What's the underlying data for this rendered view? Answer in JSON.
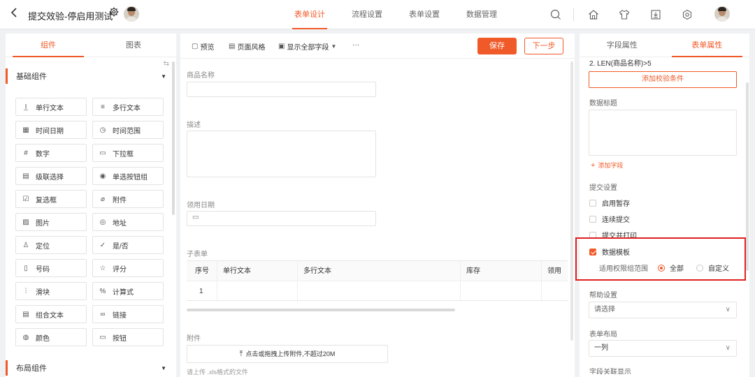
{
  "header": {
    "title": "提交效验-停启用测试",
    "tabs": [
      "表单设计",
      "流程设置",
      "表单设置",
      "数据管理"
    ],
    "active_tab": 0
  },
  "left_panel": {
    "tabs": [
      "组件",
      "图表"
    ],
    "active_tab": 0,
    "basic_section": "基础组件",
    "layout_section": "布局组件",
    "components": [
      {
        "label": "单行文本",
        "icon": "single-line-text-icon",
        "glyph": "I̲"
      },
      {
        "label": "多行文本",
        "icon": "multi-line-text-icon",
        "glyph": "≡"
      },
      {
        "label": "时间日期",
        "icon": "calendar-icon",
        "glyph": "▦"
      },
      {
        "label": "时间范围",
        "icon": "clock-icon",
        "glyph": "◷"
      },
      {
        "label": "数字",
        "icon": "number-icon",
        "glyph": "#"
      },
      {
        "label": "下拉框",
        "icon": "dropdown-icon",
        "glyph": "▭"
      },
      {
        "label": "级联选择",
        "icon": "cascade-icon",
        "glyph": "▤"
      },
      {
        "label": "单选按钮组",
        "icon": "radio-icon",
        "glyph": "◉"
      },
      {
        "label": "复选框",
        "icon": "checkbox-icon",
        "glyph": "☑"
      },
      {
        "label": "附件",
        "icon": "paperclip-icon",
        "glyph": "⌀"
      },
      {
        "label": "图片",
        "icon": "image-icon",
        "glyph": "▨"
      },
      {
        "label": "地址",
        "icon": "location-pin-icon",
        "glyph": "◎"
      },
      {
        "label": "定位",
        "icon": "locate-icon",
        "glyph": "♙"
      },
      {
        "label": "是/否",
        "icon": "yes-no-icon",
        "glyph": "✓"
      },
      {
        "label": "号码",
        "icon": "phone-icon",
        "glyph": "▯"
      },
      {
        "label": "评分",
        "icon": "star-icon",
        "glyph": "☆"
      },
      {
        "label": "滑块",
        "icon": "slider-icon",
        "glyph": "⫶"
      },
      {
        "label": "计算式",
        "icon": "formula-icon",
        "glyph": "%"
      },
      {
        "label": "组合文本",
        "icon": "composite-text-icon",
        "glyph": "▤"
      },
      {
        "label": "链接",
        "icon": "link-icon",
        "glyph": "∞"
      },
      {
        "label": "颜色",
        "icon": "palette-icon",
        "glyph": "◍"
      },
      {
        "label": "按钮",
        "icon": "button-icon",
        "glyph": "▭"
      }
    ]
  },
  "toolbar": {
    "preview": "预览",
    "page_style": "页面风格",
    "show_fields": "显示全部字段",
    "more": "···",
    "save": "保存",
    "next": "下一步"
  },
  "form": {
    "fields": [
      {
        "label": "商品名称"
      },
      {
        "label": "描述"
      },
      {
        "label": "领用日期"
      },
      {
        "label": "子表单"
      },
      {
        "label": "附件"
      }
    ],
    "subtable": {
      "headers": [
        "序号",
        "单行文本",
        "多行文本",
        "库存",
        "领用"
      ],
      "rows": [
        [
          "1",
          "",
          "",
          "",
          ""
        ]
      ]
    },
    "upload_text": "点击或拖拽上传附件,不超过20M",
    "upload_hint": "请上传 .xls格式的文件"
  },
  "right_panel": {
    "tabs": [
      "字段属性",
      "表单属性"
    ],
    "active_tab": 1,
    "condition_text": "2. LEN(商品名称)>5",
    "add_validation": "添加校验条件",
    "data_title_label": "数据标题",
    "add_field": "添加字段",
    "submit_settings_label": "提交设置",
    "submit_options": [
      {
        "label": "启用暂存",
        "checked": false
      },
      {
        "label": "连续提交",
        "checked": false
      },
      {
        "label": "提交并打印",
        "checked": false
      },
      {
        "label": "数据模板",
        "checked": true
      }
    ],
    "scope_label": "适用权限组范围",
    "scope_options": [
      {
        "label": "全部",
        "selected": true
      },
      {
        "label": "自定义",
        "selected": false
      }
    ],
    "help_label": "帮助设置",
    "help_placeholder": "请选择",
    "layout_label": "表单布局",
    "layout_value": "一列",
    "linkage_label": "字段关联显示"
  },
  "colors": {
    "accent": "#f05a28",
    "highlight": "#e02020"
  }
}
